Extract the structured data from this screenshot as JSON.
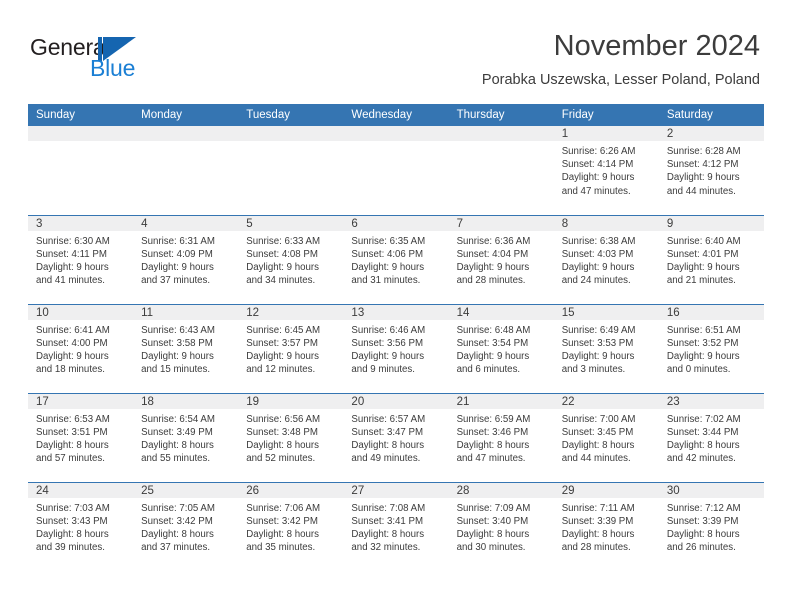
{
  "brand": {
    "name_part1": "General",
    "name_part2": "Blue",
    "mark": "triangle-logo",
    "accent_color": "#1565b0"
  },
  "header": {
    "title": "November 2024",
    "subtitle": "Porabka Uszewska, Lesser Poland, Poland"
  },
  "theme": {
    "header_blue": "#3575b2",
    "daynum_band": "#efeff0",
    "text": "#3c3c3c"
  },
  "calendar": {
    "weekday_headers": [
      "Sunday",
      "Monday",
      "Tuesday",
      "Wednesday",
      "Thursday",
      "Friday",
      "Saturday"
    ],
    "weeks": [
      [
        {
          "day": "",
          "sunrise": "",
          "sunset": "",
          "daylight_line1": "",
          "daylight_line2": ""
        },
        {
          "day": "",
          "sunrise": "",
          "sunset": "",
          "daylight_line1": "",
          "daylight_line2": ""
        },
        {
          "day": "",
          "sunrise": "",
          "sunset": "",
          "daylight_line1": "",
          "daylight_line2": ""
        },
        {
          "day": "",
          "sunrise": "",
          "sunset": "",
          "daylight_line1": "",
          "daylight_line2": ""
        },
        {
          "day": "",
          "sunrise": "",
          "sunset": "",
          "daylight_line1": "",
          "daylight_line2": ""
        },
        {
          "day": "1",
          "sunrise": "Sunrise: 6:26 AM",
          "sunset": "Sunset: 4:14 PM",
          "daylight_line1": "Daylight: 9 hours",
          "daylight_line2": "and 47 minutes."
        },
        {
          "day": "2",
          "sunrise": "Sunrise: 6:28 AM",
          "sunset": "Sunset: 4:12 PM",
          "daylight_line1": "Daylight: 9 hours",
          "daylight_line2": "and 44 minutes."
        }
      ],
      [
        {
          "day": "3",
          "sunrise": "Sunrise: 6:30 AM",
          "sunset": "Sunset: 4:11 PM",
          "daylight_line1": "Daylight: 9 hours",
          "daylight_line2": "and 41 minutes."
        },
        {
          "day": "4",
          "sunrise": "Sunrise: 6:31 AM",
          "sunset": "Sunset: 4:09 PM",
          "daylight_line1": "Daylight: 9 hours",
          "daylight_line2": "and 37 minutes."
        },
        {
          "day": "5",
          "sunrise": "Sunrise: 6:33 AM",
          "sunset": "Sunset: 4:08 PM",
          "daylight_line1": "Daylight: 9 hours",
          "daylight_line2": "and 34 minutes."
        },
        {
          "day": "6",
          "sunrise": "Sunrise: 6:35 AM",
          "sunset": "Sunset: 4:06 PM",
          "daylight_line1": "Daylight: 9 hours",
          "daylight_line2": "and 31 minutes."
        },
        {
          "day": "7",
          "sunrise": "Sunrise: 6:36 AM",
          "sunset": "Sunset: 4:04 PM",
          "daylight_line1": "Daylight: 9 hours",
          "daylight_line2": "and 28 minutes."
        },
        {
          "day": "8",
          "sunrise": "Sunrise: 6:38 AM",
          "sunset": "Sunset: 4:03 PM",
          "daylight_line1": "Daylight: 9 hours",
          "daylight_line2": "and 24 minutes."
        },
        {
          "day": "9",
          "sunrise": "Sunrise: 6:40 AM",
          "sunset": "Sunset: 4:01 PM",
          "daylight_line1": "Daylight: 9 hours",
          "daylight_line2": "and 21 minutes."
        }
      ],
      [
        {
          "day": "10",
          "sunrise": "Sunrise: 6:41 AM",
          "sunset": "Sunset: 4:00 PM",
          "daylight_line1": "Daylight: 9 hours",
          "daylight_line2": "and 18 minutes."
        },
        {
          "day": "11",
          "sunrise": "Sunrise: 6:43 AM",
          "sunset": "Sunset: 3:58 PM",
          "daylight_line1": "Daylight: 9 hours",
          "daylight_line2": "and 15 minutes."
        },
        {
          "day": "12",
          "sunrise": "Sunrise: 6:45 AM",
          "sunset": "Sunset: 3:57 PM",
          "daylight_line1": "Daylight: 9 hours",
          "daylight_line2": "and 12 minutes."
        },
        {
          "day": "13",
          "sunrise": "Sunrise: 6:46 AM",
          "sunset": "Sunset: 3:56 PM",
          "daylight_line1": "Daylight: 9 hours",
          "daylight_line2": "and 9 minutes."
        },
        {
          "day": "14",
          "sunrise": "Sunrise: 6:48 AM",
          "sunset": "Sunset: 3:54 PM",
          "daylight_line1": "Daylight: 9 hours",
          "daylight_line2": "and 6 minutes."
        },
        {
          "day": "15",
          "sunrise": "Sunrise: 6:49 AM",
          "sunset": "Sunset: 3:53 PM",
          "daylight_line1": "Daylight: 9 hours",
          "daylight_line2": "and 3 minutes."
        },
        {
          "day": "16",
          "sunrise": "Sunrise: 6:51 AM",
          "sunset": "Sunset: 3:52 PM",
          "daylight_line1": "Daylight: 9 hours",
          "daylight_line2": "and 0 minutes."
        }
      ],
      [
        {
          "day": "17",
          "sunrise": "Sunrise: 6:53 AM",
          "sunset": "Sunset: 3:51 PM",
          "daylight_line1": "Daylight: 8 hours",
          "daylight_line2": "and 57 minutes."
        },
        {
          "day": "18",
          "sunrise": "Sunrise: 6:54 AM",
          "sunset": "Sunset: 3:49 PM",
          "daylight_line1": "Daylight: 8 hours",
          "daylight_line2": "and 55 minutes."
        },
        {
          "day": "19",
          "sunrise": "Sunrise: 6:56 AM",
          "sunset": "Sunset: 3:48 PM",
          "daylight_line1": "Daylight: 8 hours",
          "daylight_line2": "and 52 minutes."
        },
        {
          "day": "20",
          "sunrise": "Sunrise: 6:57 AM",
          "sunset": "Sunset: 3:47 PM",
          "daylight_line1": "Daylight: 8 hours",
          "daylight_line2": "and 49 minutes."
        },
        {
          "day": "21",
          "sunrise": "Sunrise: 6:59 AM",
          "sunset": "Sunset: 3:46 PM",
          "daylight_line1": "Daylight: 8 hours",
          "daylight_line2": "and 47 minutes."
        },
        {
          "day": "22",
          "sunrise": "Sunrise: 7:00 AM",
          "sunset": "Sunset: 3:45 PM",
          "daylight_line1": "Daylight: 8 hours",
          "daylight_line2": "and 44 minutes."
        },
        {
          "day": "23",
          "sunrise": "Sunrise: 7:02 AM",
          "sunset": "Sunset: 3:44 PM",
          "daylight_line1": "Daylight: 8 hours",
          "daylight_line2": "and 42 minutes."
        }
      ],
      [
        {
          "day": "24",
          "sunrise": "Sunrise: 7:03 AM",
          "sunset": "Sunset: 3:43 PM",
          "daylight_line1": "Daylight: 8 hours",
          "daylight_line2": "and 39 minutes."
        },
        {
          "day": "25",
          "sunrise": "Sunrise: 7:05 AM",
          "sunset": "Sunset: 3:42 PM",
          "daylight_line1": "Daylight: 8 hours",
          "daylight_line2": "and 37 minutes."
        },
        {
          "day": "26",
          "sunrise": "Sunrise: 7:06 AM",
          "sunset": "Sunset: 3:42 PM",
          "daylight_line1": "Daylight: 8 hours",
          "daylight_line2": "and 35 minutes."
        },
        {
          "day": "27",
          "sunrise": "Sunrise: 7:08 AM",
          "sunset": "Sunset: 3:41 PM",
          "daylight_line1": "Daylight: 8 hours",
          "daylight_line2": "and 32 minutes."
        },
        {
          "day": "28",
          "sunrise": "Sunrise: 7:09 AM",
          "sunset": "Sunset: 3:40 PM",
          "daylight_line1": "Daylight: 8 hours",
          "daylight_line2": "and 30 minutes."
        },
        {
          "day": "29",
          "sunrise": "Sunrise: 7:11 AM",
          "sunset": "Sunset: 3:39 PM",
          "daylight_line1": "Daylight: 8 hours",
          "daylight_line2": "and 28 minutes."
        },
        {
          "day": "30",
          "sunrise": "Sunrise: 7:12 AM",
          "sunset": "Sunset: 3:39 PM",
          "daylight_line1": "Daylight: 8 hours",
          "daylight_line2": "and 26 minutes."
        }
      ]
    ]
  }
}
